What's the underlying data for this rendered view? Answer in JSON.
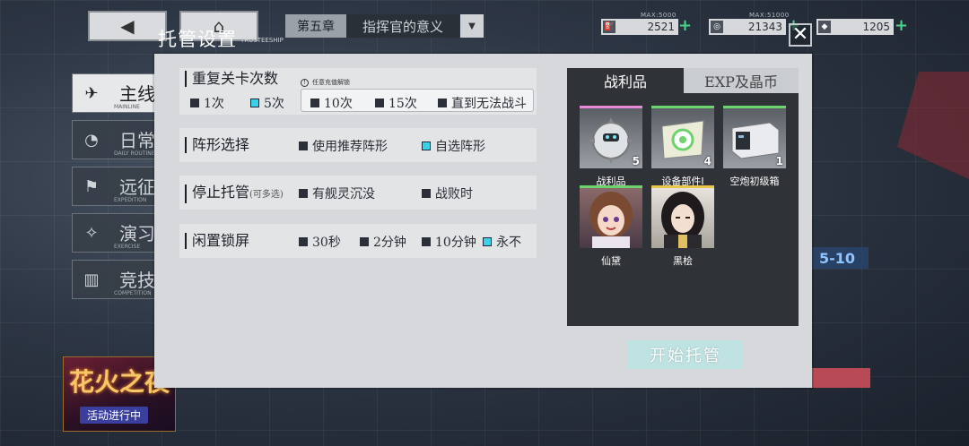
{
  "chapter": {
    "number": "第五章",
    "name": "指挥官的意义"
  },
  "resources": [
    {
      "icon": "fuel-icon",
      "max": "MAX:5000",
      "value": "2521"
    },
    {
      "icon": "coin-icon",
      "max": "MAX:51000",
      "value": "21343"
    },
    {
      "icon": "diamond-icon",
      "max": "",
      "value": "1205"
    }
  ],
  "menu": [
    {
      "label": "主线",
      "sub": "MAINLINE"
    },
    {
      "label": "日常",
      "sub": "DAILY ROUTINE"
    },
    {
      "label": "远征",
      "sub": "EXPEDITION"
    },
    {
      "label": "演习",
      "sub": "EXERCISE"
    },
    {
      "label": "竞技",
      "sub": "COMPETITION"
    }
  ],
  "event": {
    "title": "花火之夜",
    "status": "活动进行中"
  },
  "map_node": "5-10",
  "modal": {
    "title": "托管设置",
    "title_en": "TRUSTEESHIP",
    "repeat": {
      "title": "重复关卡次数",
      "warning": "任意充值解锁",
      "options": [
        "1次",
        "5次",
        "10次",
        "15次",
        "直到无法战斗"
      ]
    },
    "formation": {
      "title": "阵形选择",
      "options": [
        "使用推荐阵形",
        "自选阵形"
      ]
    },
    "stop": {
      "title": "停止托管",
      "note": "(可多选)",
      "options": [
        "有舰灵沉没",
        "战败时"
      ]
    },
    "idle": {
      "title": "闲置锁屏",
      "options": [
        "30秒",
        "2分钟",
        "10分钟",
        "永不"
      ]
    },
    "tabs": [
      "战利品",
      "EXP及晶币"
    ],
    "rewards": [
      {
        "label": "战利品",
        "count": "5",
        "color": "#e58ad6"
      },
      {
        "label": "设备部件I",
        "count": "4",
        "color": "#6dd36d"
      },
      {
        "label": "空炮初级箱",
        "count": "1",
        "color": "#6dd36d"
      },
      {
        "label": "仙黛",
        "count": "",
        "color": "#6dd36d"
      },
      {
        "label": "黑桧",
        "count": "",
        "color": "#e8c64a"
      }
    ],
    "start_button": "开始托管"
  }
}
